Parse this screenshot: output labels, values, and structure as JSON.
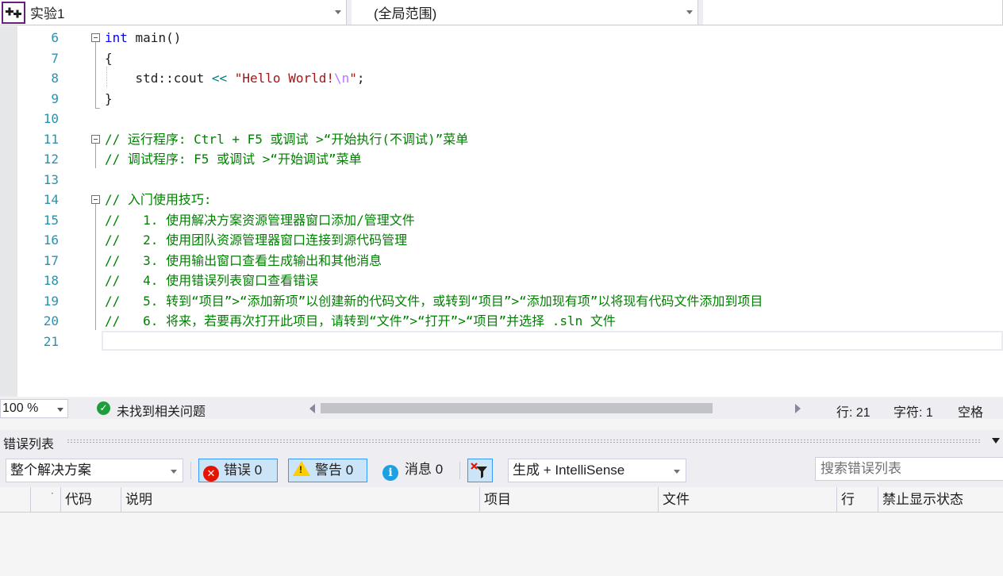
{
  "navbar": {
    "project": "实验1",
    "scope": "(全局范围)",
    "member": ""
  },
  "editor": {
    "lines": [
      {
        "n": "6"
      },
      {
        "n": "7"
      },
      {
        "n": "8"
      },
      {
        "n": "9"
      },
      {
        "n": "10"
      },
      {
        "n": "11"
      },
      {
        "n": "12"
      },
      {
        "n": "13"
      },
      {
        "n": "14"
      },
      {
        "n": "15"
      },
      {
        "n": "16"
      },
      {
        "n": "17"
      },
      {
        "n": "18"
      },
      {
        "n": "19"
      },
      {
        "n": "20"
      },
      {
        "n": "21"
      }
    ],
    "code": {
      "kw_int": "int",
      "main_sig": " main()",
      "brace_open": "{",
      "cout_prefix": "    std::cout ",
      "op_shift": "<<",
      "str_open": " \"Hello World!",
      "str_esc": "\\n",
      "str_close": "\"",
      "semicolon": ";",
      "brace_close": "}",
      "c11": "// 运行程序: Ctrl + F5 或调试 >“开始执行(不调试)”菜单",
      "c12": "// 调试程序: F5 或调试 >“开始调试”菜单",
      "c14": "// 入门使用技巧:",
      "c15": "//   1. 使用解决方案资源管理器窗口添加/管理文件",
      "c16": "//   2. 使用团队资源管理器窗口连接到源代码管理",
      "c17": "//   3. 使用输出窗口查看生成输出和其他消息",
      "c18": "//   4. 使用错误列表窗口查看错误",
      "c19": "//   5. 转到“项目”>“添加新项”以创建新的代码文件，或转到“项目”>“添加现有项”以将现有代码文件添加到项目",
      "c20": "//   6. 将来，若要再次打开此项目，请转到“文件”>“打开”>“项目”并选择 .sln 文件"
    }
  },
  "status": {
    "zoom": "100 %",
    "issues": "未找到相关问题",
    "line": "行: 21",
    "char": "字符: 1",
    "mode": "空格"
  },
  "error_list": {
    "title": "错误列表",
    "scope_filter": "整个解决方案",
    "errors_label": "错误 0",
    "warnings_label": "警告 0",
    "messages_label": "消息 0",
    "build_filter": "生成 + IntelliSense",
    "search_placeholder": "搜索错误列表",
    "columns": {
      "code": "代码",
      "description": "说明",
      "project": "项目",
      "file": "文件",
      "line": "行",
      "suppression": "禁止显示状态"
    }
  },
  "colors": {
    "keyword": "#0000ff",
    "string": "#a31515",
    "comment": "#008000",
    "line_number": "#2b91af",
    "accent": "#3399ff"
  }
}
